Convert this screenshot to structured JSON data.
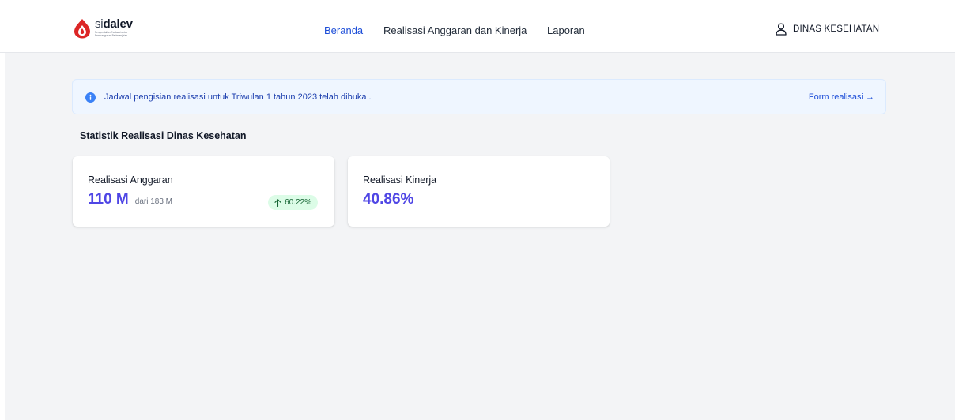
{
  "brand": {
    "name_prefix": "si",
    "name_suffix": "dalev",
    "tagline_line1": "Pengendalian Evaluasi untuk",
    "tagline_line2": "Pembangunan Berkelanjutan",
    "logo_color": "#dc2626"
  },
  "nav": {
    "items": [
      {
        "label": "Beranda",
        "active": true
      },
      {
        "label": "Realisasi Anggaran dan Kinerja",
        "active": false
      },
      {
        "label": "Laporan",
        "active": false
      }
    ],
    "active_color": "#1d4ed8"
  },
  "user": {
    "icon": "user-icon",
    "name": "DINAS KESEHATAN"
  },
  "alert": {
    "icon": "info-icon",
    "message": "Jadwal pengisian realisasi untuk Triwulan 1 tahun 2023 telah dibuka .",
    "link_label": "Form realisasi",
    "link_arrow": "→"
  },
  "stats": {
    "title": "Statistik Realisasi Dinas Kesehatan",
    "cards": [
      {
        "label": "Realisasi Anggaran",
        "value": "110 M",
        "sub": "dari 183 M",
        "badge": {
          "icon": "arrow-up-icon",
          "text": "60.22%"
        }
      },
      {
        "label": "Realisasi Kinerja",
        "value": "40.86%"
      }
    ],
    "accent_color": "#4f46e5",
    "badge_bg": "#dcfce7",
    "badge_color": "#166534"
  }
}
